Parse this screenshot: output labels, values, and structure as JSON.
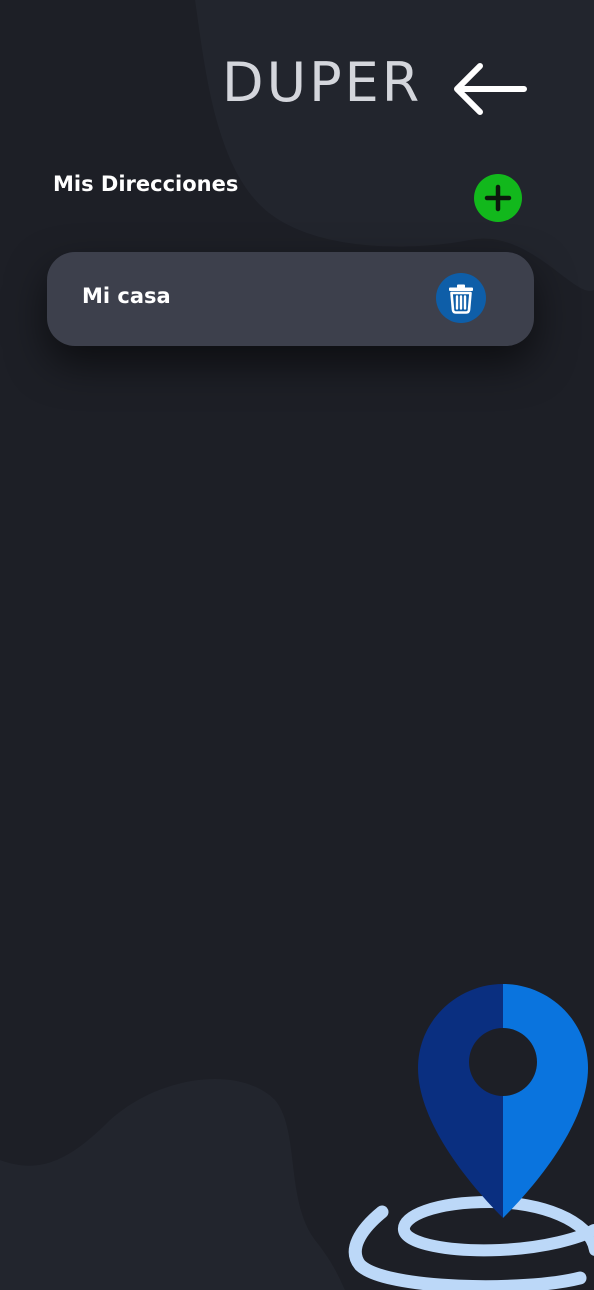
{
  "header": {
    "logo_text": "DUPER",
    "back_icon": "arrow-left-icon"
  },
  "addresses_section": {
    "title": "Mis Direcciones",
    "add_icon": "plus-icon",
    "add_color": "#12b81c"
  },
  "addresses": [
    {
      "name": "Mi casa",
      "delete_icon": "trash-icon",
      "delete_color": "#0e5ea8"
    }
  ],
  "illustration": {
    "icon": "location-pin-icon",
    "colors": [
      "#0a2f80",
      "#0a74de",
      "#bcd8f8"
    ]
  },
  "theme": {
    "background": "#1d1f26",
    "card": "#3d404c"
  }
}
